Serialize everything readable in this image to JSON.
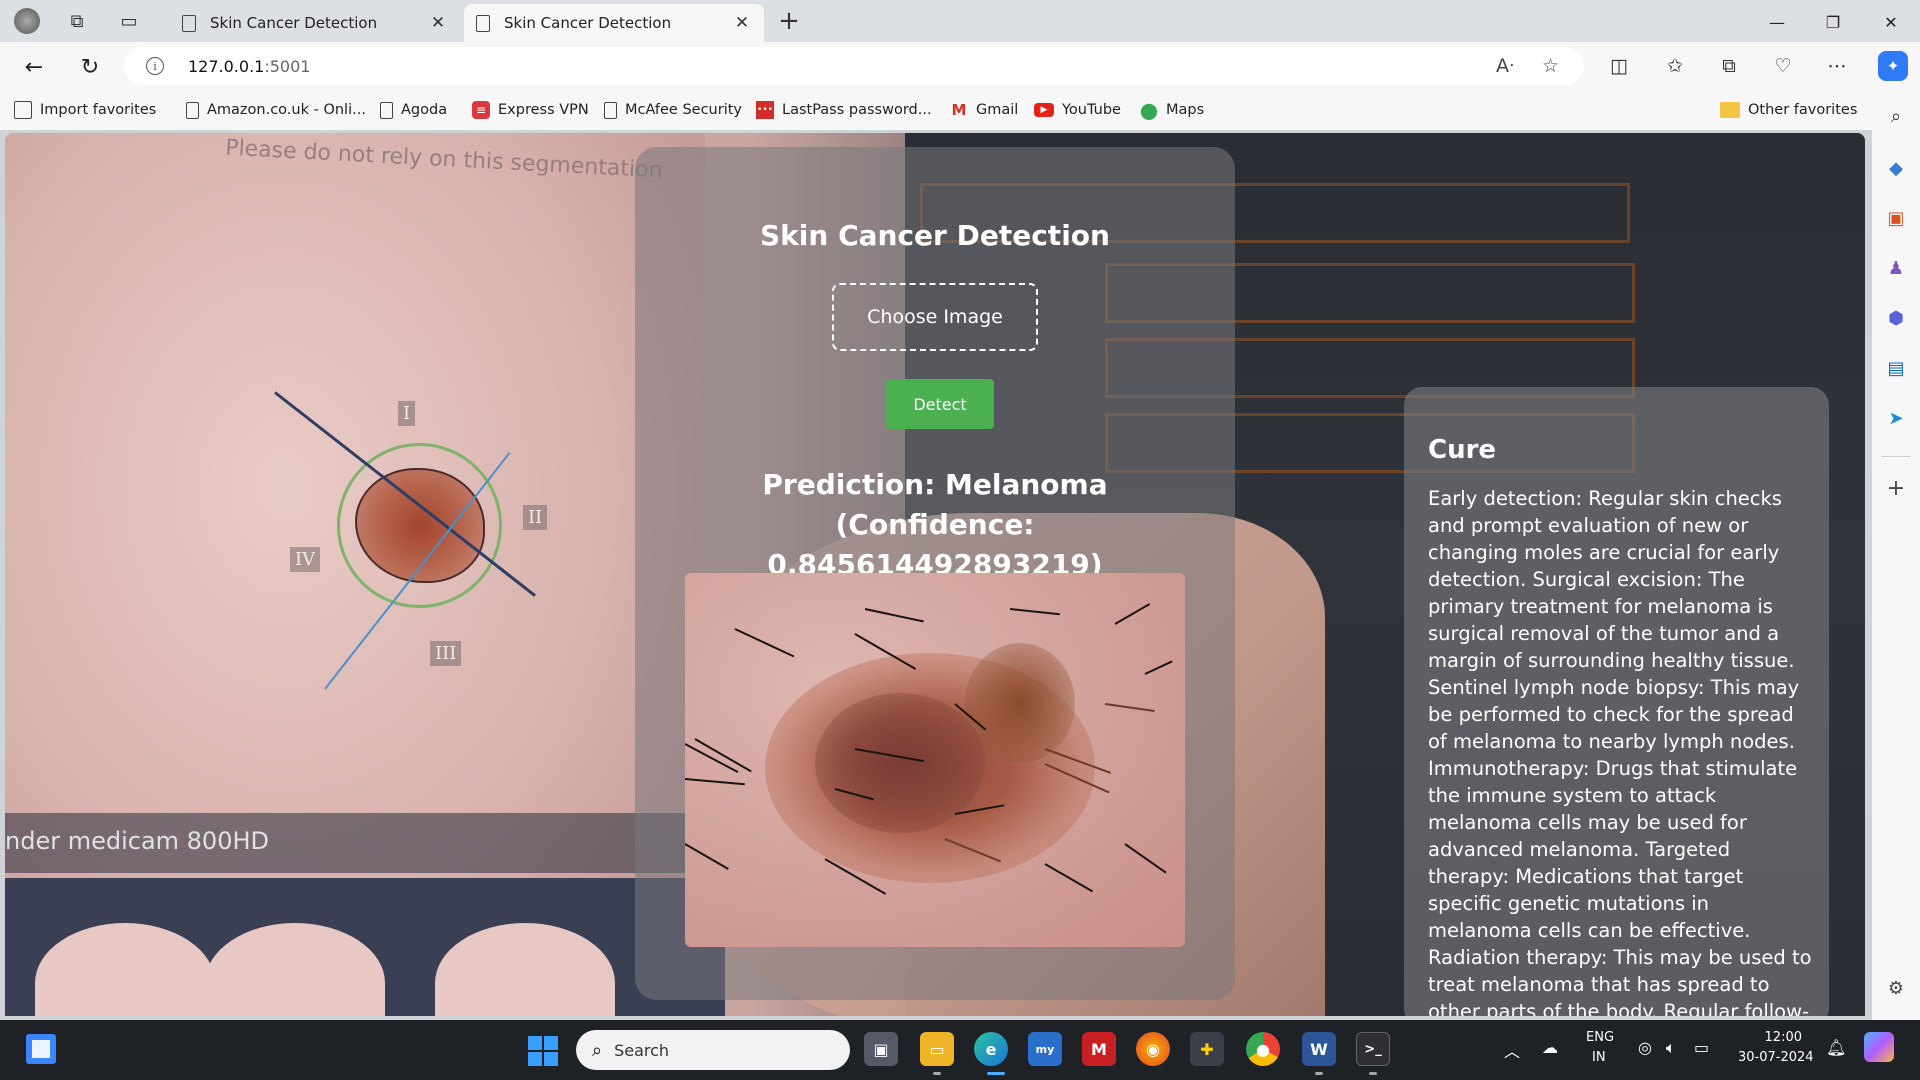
{
  "browser": {
    "tabs": [
      {
        "title": "Skin Cancer Detection",
        "active": false
      },
      {
        "title": "Skin Cancer Detection",
        "active": true
      }
    ],
    "new_tab_icon": "plus-icon",
    "address": {
      "host": "127.0.0.1",
      "port": ":5001"
    },
    "favorites": [
      {
        "label": "Import favorites",
        "icon": "import-icon"
      },
      {
        "label": "Amazon.co.uk - Onli...",
        "icon": "page-icon"
      },
      {
        "label": "Agoda",
        "icon": "page-icon"
      },
      {
        "label": "Express VPN",
        "icon": "expressvpn-icon"
      },
      {
        "label": "McAfee Security",
        "icon": "page-icon"
      },
      {
        "label": "LastPass password...",
        "icon": "lastpass-icon"
      },
      {
        "label": "Gmail",
        "icon": "gmail-icon"
      },
      {
        "label": "YouTube",
        "icon": "youtube-icon"
      },
      {
        "label": "Maps",
        "icon": "maps-icon"
      }
    ],
    "other_favorites": "Other favorites"
  },
  "page": {
    "background_texts": {
      "top": "Please do not rely on this segmentation",
      "bottom": "nder medicam 800HD",
      "roman": [
        "I",
        "II",
        "III",
        "IV"
      ]
    },
    "card": {
      "title": "Skin Cancer Detection",
      "choose_label": "Choose Image",
      "detect_label": "Detect",
      "prediction": "Prediction: Melanoma (Confidence: 0.845614492893219)"
    },
    "cure": {
      "title": "Cure",
      "text": "Early detection: Regular skin checks and prompt evaluation of new or changing moles are crucial for early detection. Surgical excision: The primary treatment for melanoma is surgical removal of the tumor and a margin of surrounding healthy tissue. Sentinel lymph node biopsy: This may be performed to check for the spread of melanoma to nearby lymph nodes. Immunotherapy: Drugs that stimulate the immune system to attack melanoma cells may be used for advanced melanoma. Targeted therapy: Medications that target specific genetic mutations in melanoma cells can be effective. Radiation therapy: This may be used to treat melanoma that has spread to other parts of the body. Regular follow-up: Patients treated for melanoma need regular follow-up appointments to monitor for"
    },
    "colors": {
      "detect": "#4caf50",
      "card": "#78787d"
    }
  },
  "taskbar": {
    "search_placeholder": "Search",
    "lang_top": "ENG",
    "lang_bottom": "IN",
    "time": "12:00",
    "date": "30-07-2024"
  }
}
